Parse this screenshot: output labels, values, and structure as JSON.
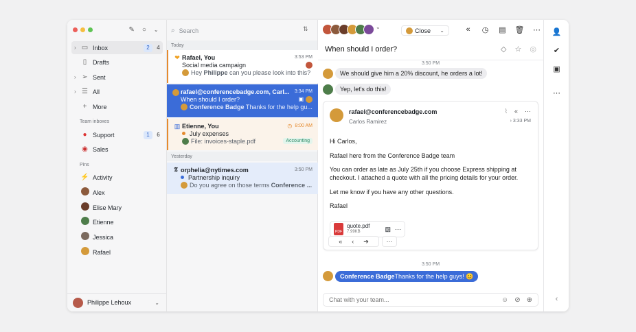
{
  "colors": {
    "accent": "#3b6cd8",
    "red": "#ec5f5a",
    "yellow": "#f5be40",
    "green": "#5fc454",
    "orange": "#e58a2e"
  },
  "sidebar": {
    "items": [
      {
        "label": "Inbox",
        "badge1": "2",
        "badge2": "4"
      },
      {
        "label": "Drafts"
      },
      {
        "label": "Sent"
      },
      {
        "label": "All"
      },
      {
        "label": "More"
      }
    ],
    "team_heading": "Team inboxes",
    "team": [
      {
        "label": "Support",
        "badge1": "1",
        "badge2": "6"
      },
      {
        "label": "Sales"
      }
    ],
    "pins_heading": "Pins",
    "pins": [
      "Activity",
      "Alex",
      "Elise Mary",
      "Etienne",
      "Jessica",
      "Rafael"
    ],
    "user": "Philippe Lehoux"
  },
  "list": {
    "search_placeholder": "Search",
    "group_today": "Today",
    "group_yesterday": "Yesterday",
    "cards": [
      {
        "from": "Rafael, You",
        "time": "3:53 PM",
        "subject": "Social media campaign",
        "preview_prefix": "Hey ",
        "preview_bold": "Philippe",
        "preview": " can you please look into this?"
      },
      {
        "from": "rafael@conferencebadge.com, Carl...",
        "time": "3:34 PM",
        "subject": "When should I order?",
        "preview_bold": "Conference Badge",
        "preview": " Thanks for the help gu..."
      },
      {
        "from": "Etienne, You",
        "time": "8:00 AM",
        "subject": "July expenses",
        "preview": "File: invoices-staple.pdf",
        "tag": "Accounting"
      },
      {
        "from": "orphelia@nytimes.com",
        "time": "3:50 PM",
        "subject": "Partnership inquiry",
        "preview": "Do you agree on those terms ",
        "preview_bold": "Conference ..."
      }
    ]
  },
  "conversation": {
    "close_label": "Close",
    "subject": "When should I order?",
    "stamp1": "3:50 PM",
    "msg1": "We should give him a 20% discount, he orders a lot!",
    "msg2": "Yep, let's do this!",
    "mail": {
      "from": "rafael@conferencebadge.com",
      "name": "Carlos Ramirez",
      "time": "3:33 PM",
      "p1": "Hi Carlos,",
      "p2": "Rafael here from the Conference Badge team",
      "p3": "You can order as late as July 25th if you choose Express shipping at checkout. I attached a quote with all the pricing details for your order.",
      "p4": "Let me know if you have any other questions.",
      "p5": "Rafael",
      "attachment_name": "quote.pdf",
      "attachment_size": "7.99KB",
      "pdf_label": "PDF"
    },
    "stamp2": "3:50 PM",
    "final_bold": "Conference Badge",
    "final_text": " Thanks for the help guys! 😊",
    "compose_placeholder": "Chat with your team..."
  }
}
